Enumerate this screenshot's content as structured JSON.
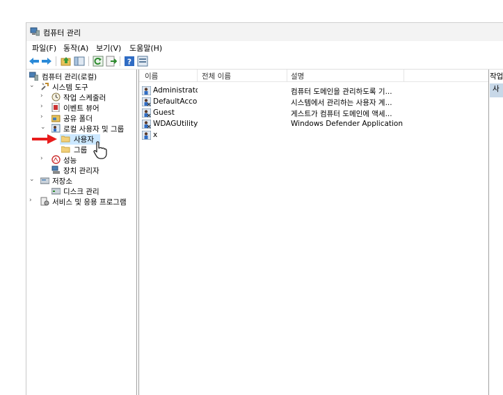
{
  "window": {
    "title": "컴퓨터 관리"
  },
  "menu": [
    {
      "label": "파일(F)"
    },
    {
      "label": "동작(A)"
    },
    {
      "label": "보기(V)"
    },
    {
      "label": "도움말(H)"
    }
  ],
  "toolbar": [
    {
      "icon": "back-arrow-icon"
    },
    {
      "icon": "forward-arrow-icon"
    },
    {
      "icon": "up-folder-icon"
    },
    {
      "icon": "show-hide-tree-icon"
    },
    {
      "icon": "refresh-icon"
    },
    {
      "icon": "export-list-icon"
    },
    {
      "icon": "help-icon"
    },
    {
      "icon": "properties-icon"
    }
  ],
  "tree": {
    "root": "컴퓨터 관리(로컬)",
    "system_tools": "시스템 도구",
    "task_scheduler": "작업 스케줄러",
    "event_viewer": "이벤트 뷰어",
    "shared_folders": "공유 폴더",
    "local_users_groups": "로컬 사용자 및 그룹",
    "users": "사용자",
    "groups": "그룹",
    "performance": "성능",
    "device_manager": "장치 관리자",
    "storage": "저장소",
    "disk_management": "디스크 관리",
    "services_apps": "서비스 및 응용 프로그램"
  },
  "list": {
    "columns": [
      "이름",
      "전체 이름",
      "설명"
    ],
    "rows": [
      {
        "name": "Administrator",
        "full_name": "",
        "description": "컴퓨터 도메인을 관리하도록 기..."
      },
      {
        "name": "DefaultAcco...",
        "full_name": "",
        "description": "시스템에서 관리하는 사용자 계..."
      },
      {
        "name": "Guest",
        "full_name": "",
        "description": "게스트가 컴퓨터 도메인에 액세..."
      },
      {
        "name": "WDAGUtility...",
        "full_name": "",
        "description": "Windows Defender Application G..."
      },
      {
        "name": "x",
        "full_name": "",
        "description": ""
      }
    ]
  },
  "actions": {
    "header": "작업",
    "item": "사"
  },
  "colors": {
    "selection": "#cce8ff",
    "annotation_arrow": "#e81c1c",
    "action_item": "#c8d8e8"
  }
}
